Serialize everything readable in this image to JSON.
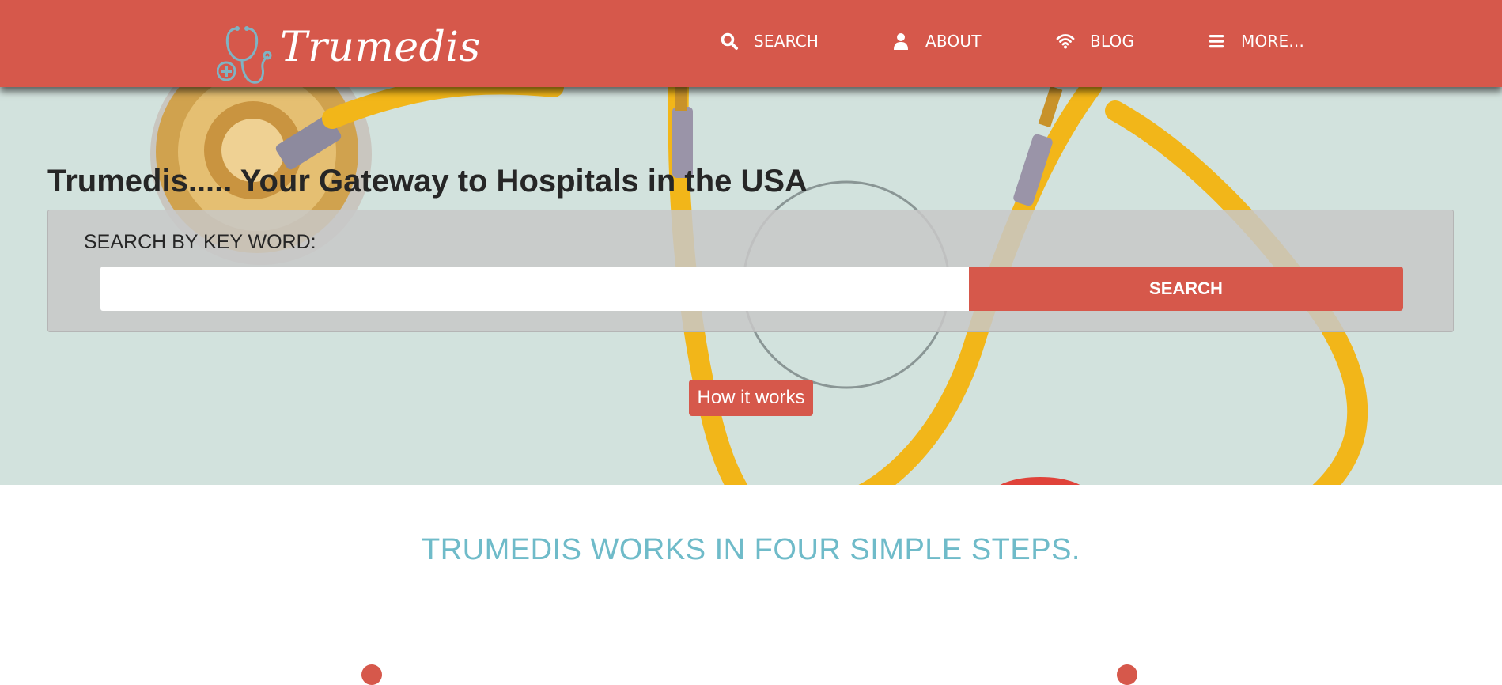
{
  "brand": {
    "name": "Trumedis",
    "icon": "stethoscope-icon"
  },
  "nav": {
    "items": [
      {
        "label": "SEARCH",
        "icon": "search-icon"
      },
      {
        "label": "ABOUT",
        "icon": "user-icon"
      },
      {
        "label": "BLOG",
        "icon": "wifi-icon"
      },
      {
        "label": "MORE...",
        "icon": "menu-icon"
      }
    ]
  },
  "hero": {
    "headline": "Trumedis..... Your Gateway to Hospitals in the USA",
    "search": {
      "label": "SEARCH BY KEY WORD:",
      "input_value": "",
      "placeholder": "",
      "button_label": "SEARCH"
    },
    "how_button_label": "How it works"
  },
  "steps": {
    "title": "TRUMEDIS WORKS IN FOUR SIMPLE STEPS."
  },
  "colors": {
    "primary": "#d6584b",
    "accent": "#6fbbc9",
    "text": "#262626"
  }
}
